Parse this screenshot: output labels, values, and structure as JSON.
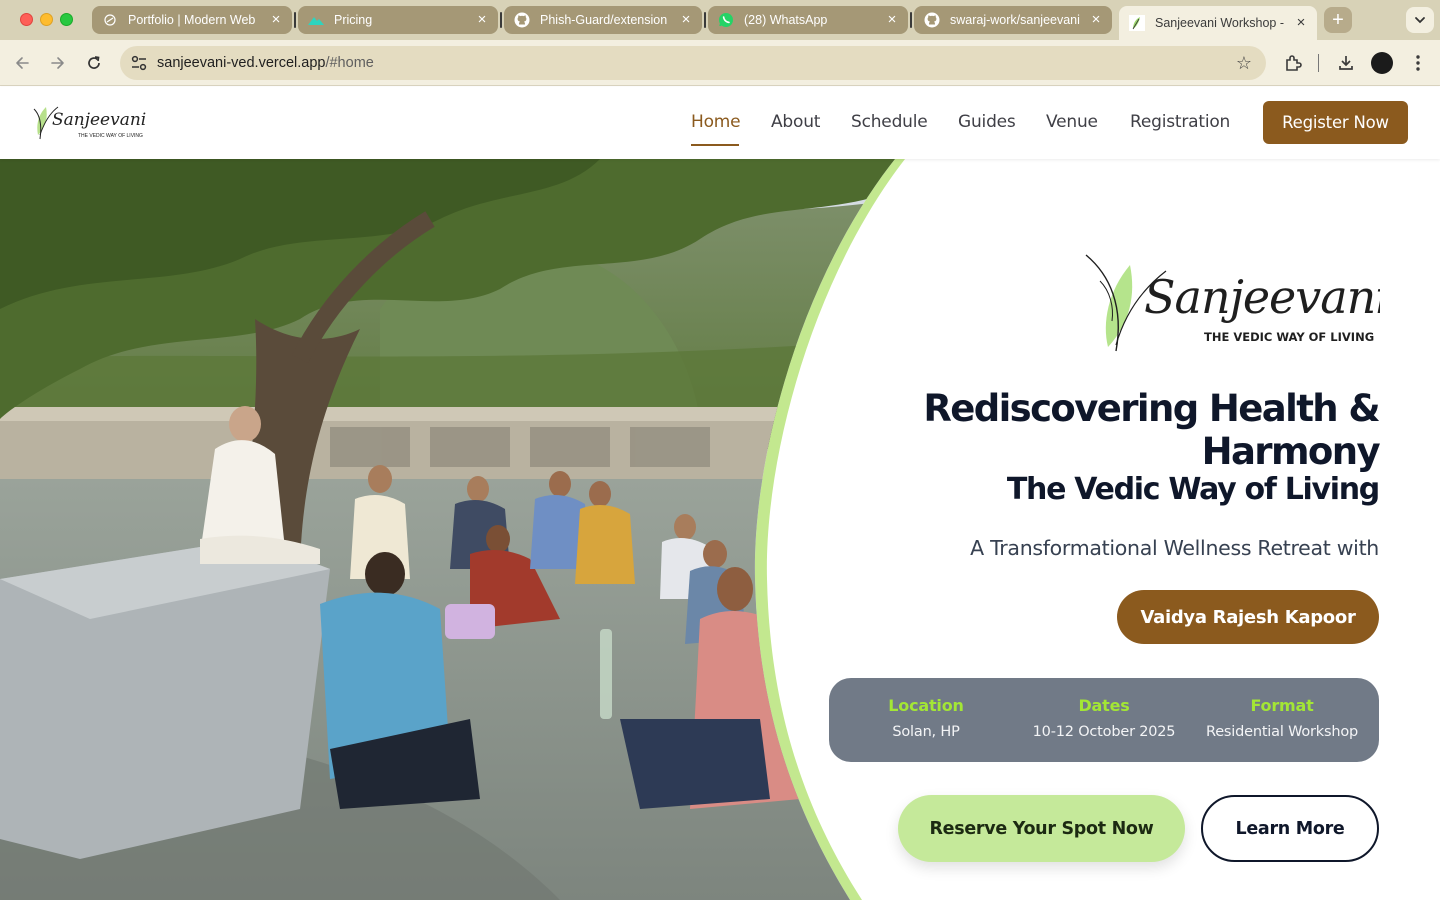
{
  "browser": {
    "tabs": [
      {
        "title": "Portfolio | Modern Web",
        "icon": "globe-icon"
      },
      {
        "title": "Pricing",
        "icon": "mountain-logo-icon"
      },
      {
        "title": "Phish-Guard/extension",
        "icon": "github-icon"
      },
      {
        "title": "(28) WhatsApp",
        "icon": "whatsapp-icon"
      },
      {
        "title": "swaraj-work/sanjeevani",
        "icon": "github-icon"
      },
      {
        "title": "Sanjeevani Workshop -",
        "icon": "sanjeevani-leaf-icon",
        "active": true
      }
    ],
    "url_host": "sanjeevani-ved.vercel.app",
    "url_path": "/#home"
  },
  "site": {
    "logo_word": "Sanjeevani",
    "logo_tagline": "THE VEDIC WAY OF LIVING",
    "nav": [
      "Home",
      "About",
      "Schedule",
      "Guides",
      "Venue",
      "Registration"
    ],
    "active_nav": "Home",
    "register_label": "Register Now"
  },
  "hero": {
    "logo_word": "Sanjeevani",
    "logo_tagline": "THE VEDIC WAY OF LIVING",
    "title_line1": "Rediscovering Health &",
    "title_line2": "Harmony",
    "subtitle": "The Vedic Way of Living",
    "intro": "A Transformational Wellness Retreat with",
    "guide_name": "Vaidya Rajesh Kapoor",
    "info": [
      {
        "label": "Location",
        "value": "Solan, HP"
      },
      {
        "label": "Dates",
        "value": "10-12 October 2025"
      },
      {
        "label": "Format",
        "value": "Residential Workshop"
      }
    ],
    "cta_primary": "Reserve Your Spot Now",
    "cta_secondary": "Learn More",
    "colors": {
      "brown": "#8b5a1e",
      "lime": "#a3e635",
      "pale_green": "#c5e99a",
      "card": "#717a87",
      "navy": "#0f172a"
    }
  }
}
